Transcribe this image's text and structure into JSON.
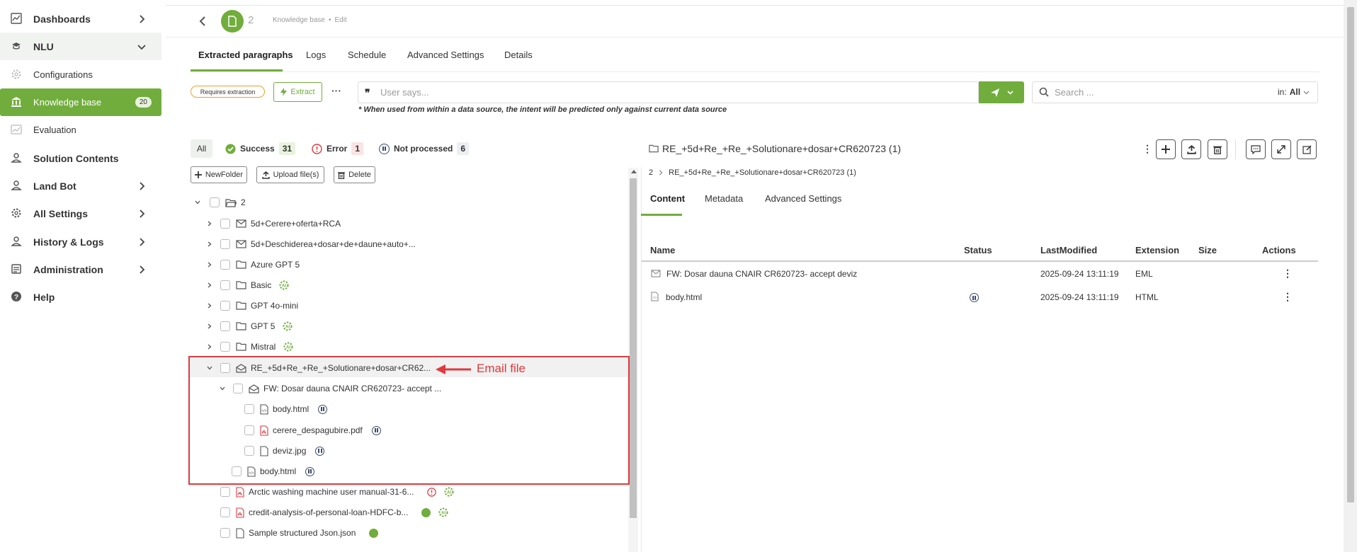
{
  "sidebar": {
    "items": [
      {
        "label": "Dashboards"
      },
      {
        "label": "NLU"
      },
      {
        "label": "Configurations"
      },
      {
        "label": "Knowledge base",
        "badge": "20"
      },
      {
        "label": "Evaluation"
      },
      {
        "label": "Solution Contents"
      },
      {
        "label": "Land Bot"
      },
      {
        "label": "All Settings"
      },
      {
        "label": "History & Logs"
      },
      {
        "label": "Administration"
      },
      {
        "label": "Help"
      }
    ]
  },
  "header": {
    "doc_number": "2",
    "breadcrumb": "Knowledge base",
    "breadcrumb_sep": "•",
    "mode": "Edit"
  },
  "tabs": [
    "Extracted paragraphs",
    "Logs",
    "Schedule",
    "Advanced Settings",
    "Details"
  ],
  "toolbar": {
    "requires_extraction": "Requires extraction",
    "extract": "Extract",
    "user_says_placeholder": "User says...",
    "hint": "* When used from within a data source, the intent will be predicted only against current data source",
    "search_placeholder": "Search ...",
    "search_in_label": "in:",
    "search_in_value": "All"
  },
  "filters": {
    "all": "All",
    "success": "Success",
    "success_count": "31",
    "error": "Error",
    "error_count": "1",
    "not_processed": "Not processed",
    "not_processed_count": "6"
  },
  "actions": {
    "new_folder": "NewFolder",
    "upload": "Upload file(s)",
    "delete": "Delete"
  },
  "tree": [
    {
      "name": "2"
    },
    {
      "name": "5d+Cerere+oferta+RCA"
    },
    {
      "name": "5d+Deschiderea+dosar+de+daune+auto+..."
    },
    {
      "name": "Azure GPT 5"
    },
    {
      "name": "Basic"
    },
    {
      "name": "GPT 4o-mini"
    },
    {
      "name": "GPT 5"
    },
    {
      "name": "Mistral"
    },
    {
      "name": "RE_+5d+Re_+Re_+Solutionare+dosar+CR62..."
    },
    {
      "name": "FW: Dosar dauna CNAIR CR620723- accept ..."
    },
    {
      "name": "body.html"
    },
    {
      "name": "cerere_despagubire.pdf"
    },
    {
      "name": "deviz.jpg"
    },
    {
      "name": "body.html"
    },
    {
      "name": "Arctic washing machine user manual-31-6..."
    },
    {
      "name": "credit-analysis-of-personal-loan-HDFC-b..."
    },
    {
      "name": "Sample structured Json.json"
    }
  ],
  "annotation": {
    "label": "Email file",
    "color": "#e0393e"
  },
  "detail": {
    "title": "RE_+5d+Re_+Re_+Solutionare+dosar+CR620723 (1)",
    "breadcrumb_root": "2",
    "breadcrumb_leaf": "RE_+5d+Re_+Re_+Solutionare+dosar+CR620723 (1)",
    "tabs": [
      "Content",
      "Metadata",
      "Advanced Settings"
    ],
    "columns": [
      "Name",
      "Status",
      "LastModified",
      "Extension",
      "Size",
      "Actions"
    ],
    "rows": [
      {
        "name": "FW: Dosar dauna CNAIR CR620723- accept deviz",
        "status": "",
        "modified": "2025-09-24 13:11:19",
        "ext": "EML",
        "size": ""
      },
      {
        "name": "body.html",
        "status": "not-processed",
        "modified": "2025-09-24 13:11:19",
        "ext": "HTML",
        "size": ""
      }
    ]
  },
  "colors": {
    "accent": "#71ad3c",
    "error": "#e0393e",
    "status_dark": "#3a4a6b"
  }
}
